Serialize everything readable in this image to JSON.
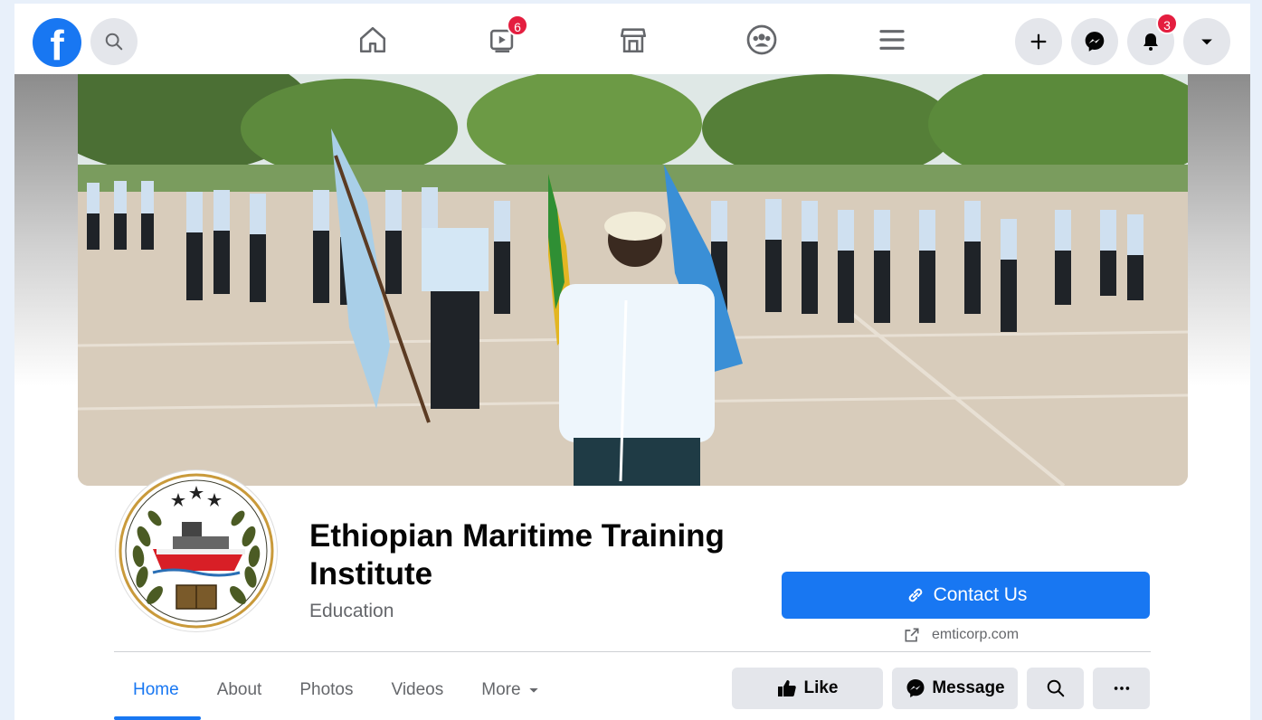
{
  "header": {
    "logo_label": "f",
    "icons": [
      "facebook-logo",
      "search-icon",
      "home-icon",
      "watch-icon",
      "marketplace-icon",
      "groups-icon",
      "menu-icon",
      "create-icon",
      "messenger-icon",
      "notifications-icon",
      "account-dropdown-icon"
    ],
    "watch_badge": "6",
    "notifications_badge": "3"
  },
  "page": {
    "name": "Ethiopian Maritime Training Institute",
    "category": "Education",
    "contact_label": "Contact Us",
    "website": "emticorp.com"
  },
  "tabs": [
    {
      "label": "Home"
    },
    {
      "label": "About"
    },
    {
      "label": "Photos"
    },
    {
      "label": "Videos"
    },
    {
      "label": "More"
    }
  ],
  "actions": {
    "like_label": "Like",
    "message_label": "Message"
  },
  "colors": {
    "brand": "#1877f2",
    "badge": "#e41e3f",
    "button_bg": "#e4e6eb",
    "muted_text": "#65676b"
  }
}
